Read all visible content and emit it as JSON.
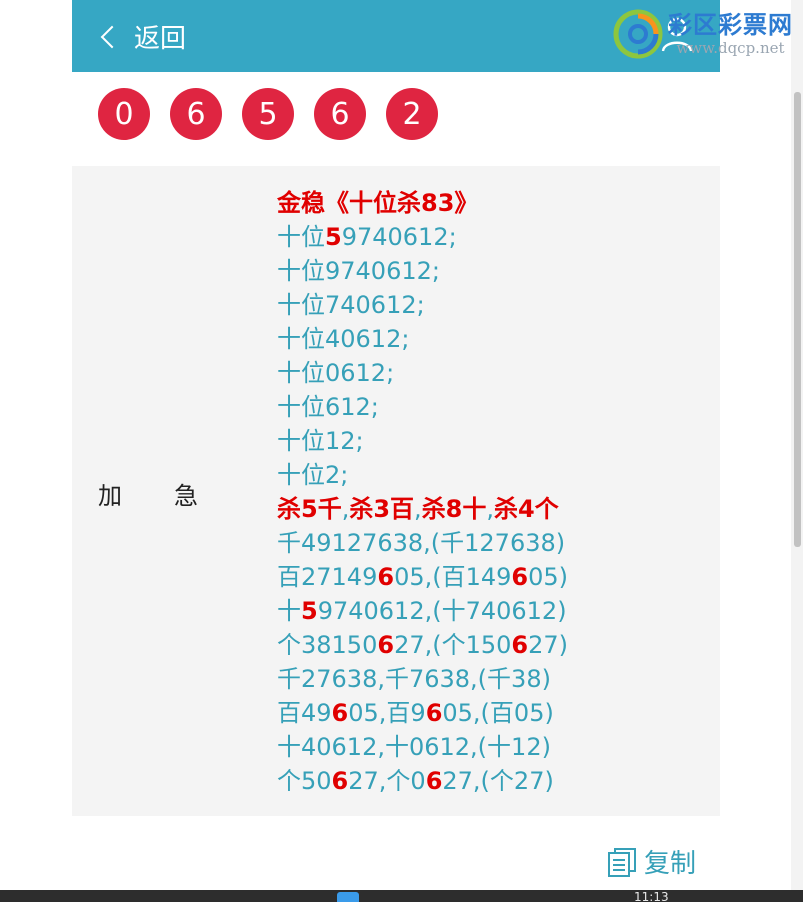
{
  "header": {
    "back_label": "返回"
  },
  "watermark": {
    "name": "彩区彩票网",
    "url": "www.dqcp.net"
  },
  "balls": [
    "0",
    "6",
    "5",
    "6",
    "2"
  ],
  "label": "加急",
  "lines": [
    [
      {
        "t": "金稳《十位杀83》",
        "r": true
      }
    ],
    [
      {
        "t": "十位"
      },
      {
        "t": "5",
        "r": true
      },
      {
        "t": "9740612;"
      }
    ],
    [
      {
        "t": "十位9740612;"
      }
    ],
    [
      {
        "t": "十位740612;"
      }
    ],
    [
      {
        "t": "十位40612;"
      }
    ],
    [
      {
        "t": "十位0612;"
      }
    ],
    [
      {
        "t": "十位612;"
      }
    ],
    [
      {
        "t": "十位12;"
      }
    ],
    [
      {
        "t": "十位2;"
      }
    ],
    [
      {
        "t": "杀5千",
        "r": true
      },
      {
        "t": ","
      },
      {
        "t": "杀3百",
        "r": true
      },
      {
        "t": ","
      },
      {
        "t": "杀8十",
        "r": true
      },
      {
        "t": ","
      },
      {
        "t": "杀4个",
        "r": true
      }
    ],
    [
      {
        "t": "千49127638,(千127638)"
      }
    ],
    [
      {
        "t": "百27149"
      },
      {
        "t": "6",
        "r": true
      },
      {
        "t": "05,(百149"
      },
      {
        "t": "6",
        "r": true
      },
      {
        "t": "05)"
      }
    ],
    [
      {
        "t": "十"
      },
      {
        "t": "5",
        "r": true
      },
      {
        "t": "9740612,(十740612)"
      }
    ],
    [
      {
        "t": "个38150"
      },
      {
        "t": "6",
        "r": true
      },
      {
        "t": "27,(个150"
      },
      {
        "t": "6",
        "r": true
      },
      {
        "t": "27)"
      }
    ],
    [
      {
        "t": "千27638,千7638,(千38)"
      }
    ],
    [
      {
        "t": "百49"
      },
      {
        "t": "6",
        "r": true
      },
      {
        "t": "05,百9"
      },
      {
        "t": "6",
        "r": true
      },
      {
        "t": "05,(百05)"
      }
    ],
    [
      {
        "t": "十40612,十0612,(十12)"
      }
    ],
    [
      {
        "t": "个50"
      },
      {
        "t": "6",
        "r": true
      },
      {
        "t": "27,个0"
      },
      {
        "t": "6",
        "r": true
      },
      {
        "t": "27,(个27)"
      }
    ]
  ],
  "copy_label": "复制",
  "taskbar": {
    "clock": "11:13"
  },
  "colors": {
    "header_bg": "#36a7c4",
    "ball": "#df2541",
    "text": "#36a0b8",
    "highlight": "#e00000"
  }
}
